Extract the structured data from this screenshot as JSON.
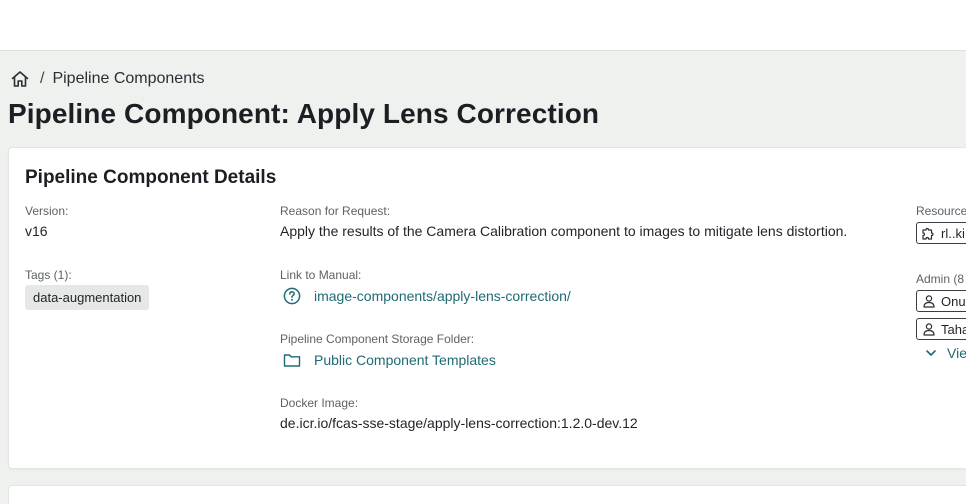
{
  "breadcrumb": {
    "home_icon": "home-icon",
    "separator": "/",
    "current": "Pipeline Components"
  },
  "page": {
    "title": "Pipeline Component: Apply Lens Correction"
  },
  "details": {
    "title": "Pipeline Component Details",
    "version_label": "Version:",
    "version_value": "v16",
    "tags_label": "Tags (1):",
    "tags": [
      "data-augmentation"
    ],
    "reason_label": "Reason for Request:",
    "reason_value": "Apply the results of the Camera Calibration component to images to mitigate lens distortion.",
    "manual_label": "Link to Manual:",
    "manual_link": "image-components/apply-lens-correction/",
    "manual_icon": "help-circle-icon",
    "storage_label": "Pipeline Component Storage Folder:",
    "storage_link": "Public Component Templates",
    "storage_icon": "folder-icon",
    "docker_label": "Docker Image:",
    "docker_value": "de.icr.io/fcas-sse-stage/apply-lens-correction:1.2.0-dev.12",
    "resource_label": "Resource",
    "resource_chip": "rl..ki",
    "resource_icon": "puzzle-icon",
    "admin_label": "Admin (8",
    "admins": [
      "Onur",
      "Taha"
    ],
    "admin_icon": "user-icon",
    "view_more": "Vie",
    "view_more_icon": "chevron-down-icon"
  },
  "colors": {
    "accent": "#1f6a73",
    "background": "#eff1ef",
    "card": "#ffffff",
    "tag_bg": "#e6e8e6"
  }
}
